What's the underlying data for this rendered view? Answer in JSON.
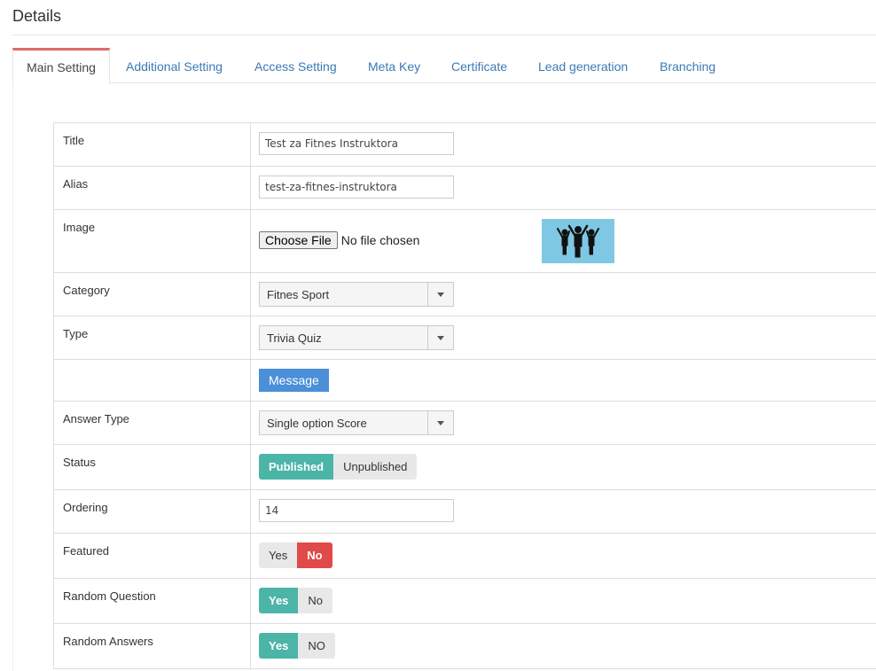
{
  "header": {
    "title": "Details"
  },
  "tabs": [
    {
      "label": "Main Setting"
    },
    {
      "label": "Additional Setting"
    },
    {
      "label": "Access Setting"
    },
    {
      "label": "Meta Key"
    },
    {
      "label": "Certificate"
    },
    {
      "label": "Lead generation"
    },
    {
      "label": "Branching"
    }
  ],
  "form": {
    "title": {
      "label": "Title",
      "value": "Test za Fitnes Instruktora"
    },
    "alias": {
      "label": "Alias",
      "value": "test-za-fitnes-instruktora"
    },
    "image": {
      "label": "Image",
      "button": "Choose File",
      "status": "No file chosen",
      "thumbnail_icon": "people-cheering-icon"
    },
    "category": {
      "label": "Category",
      "value": "Fitnes Sport"
    },
    "type": {
      "label": "Type",
      "value": "Trivia Quiz"
    },
    "message": {
      "button": "Message"
    },
    "answer_type": {
      "label": "Answer Type",
      "value": "Single option Score"
    },
    "status": {
      "label": "Status",
      "options": [
        "Published",
        "Unpublished"
      ],
      "selected": "Published"
    },
    "ordering": {
      "label": "Ordering",
      "value": "14"
    },
    "featured": {
      "label": "Featured",
      "options": [
        "Yes",
        "No"
      ],
      "selected": "No"
    },
    "random_question": {
      "label": "Random Question",
      "options": [
        "Yes",
        "No"
      ],
      "selected": "Yes"
    },
    "random_answers": {
      "label": "Random Answers",
      "options": [
        "Yes",
        "NO"
      ],
      "selected": "Yes"
    }
  },
  "colors": {
    "accent_tab": "#e06b6b",
    "toggle_on": "#4bb5a7",
    "toggle_danger": "#e04a4a",
    "link": "#3c78b4",
    "message_btn": "#4a8fd8"
  }
}
